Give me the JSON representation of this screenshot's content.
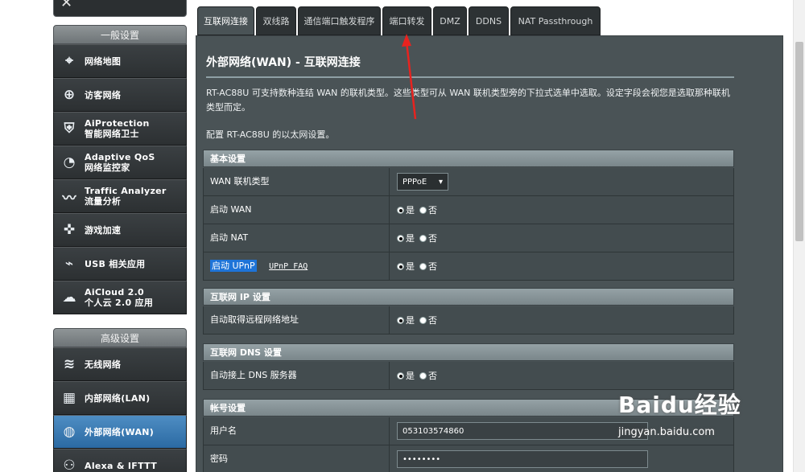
{
  "sidebar": {
    "top_label": "",
    "general_header": "一般设置",
    "advanced_header": "高级设置",
    "general_items": [
      {
        "icon": "network-map-icon",
        "line1": "网络地图",
        "line2": ""
      },
      {
        "icon": "guest-network-icon",
        "line1": "访客网络",
        "line2": ""
      },
      {
        "icon": "aiprotection-icon",
        "line1": "AiProtection",
        "line2": "智能网络卫士"
      },
      {
        "icon": "adaptive-qos-icon",
        "line1": "Adaptive QoS",
        "line2": "网络监控家"
      },
      {
        "icon": "traffic-analyzer-icon",
        "line1": "Traffic Analyzer",
        "line2": "流量分析"
      },
      {
        "icon": "game-boost-icon",
        "line1": "游戏加速",
        "line2": ""
      },
      {
        "icon": "usb-icon",
        "line1": "USB 相关应用",
        "line2": ""
      },
      {
        "icon": "aicloud-icon",
        "line1": "AiCloud 2.0",
        "line2": "个人云 2.0 应用"
      }
    ],
    "advanced_items": [
      {
        "icon": "wireless-icon",
        "line1": "无线网络",
        "line2": "",
        "active": false
      },
      {
        "icon": "lan-icon",
        "line1": "内部网络(LAN)",
        "line2": "",
        "active": false
      },
      {
        "icon": "wan-globe-icon",
        "line1": "外部网络(WAN)",
        "line2": "",
        "active": true
      },
      {
        "icon": "alexa-icon",
        "line1": "Alexa & IFTTT",
        "line2": "",
        "active": false
      }
    ]
  },
  "tabs": [
    {
      "label": "互联网连接",
      "active": true
    },
    {
      "label": "双线路",
      "active": false
    },
    {
      "label": "通信端口触发程序",
      "active": false
    },
    {
      "label": "端口转发",
      "active": false
    },
    {
      "label": "DMZ",
      "active": false
    },
    {
      "label": "DDNS",
      "active": false
    },
    {
      "label": "NAT Passthrough",
      "active": false
    }
  ],
  "main": {
    "title": "外部网络(WAN) - 互联网连接",
    "description": "RT-AC88U 可支持数种连结 WAN 的联机类型。这些类型可从 WAN 联机类型旁的下拉式选单中选取。设定字段会视您是选取那种联机类型而定。",
    "config_note": "配置 RT-AC88U 的以太网设置。"
  },
  "sections": {
    "basic": {
      "header": "基本设置",
      "wan_type_label": "WAN 联机类型",
      "wan_type_value": "PPPoE",
      "enable_wan_label": "启动 WAN",
      "enable_nat_label": "启动 NAT",
      "enable_upnp_label": "启动 UPnP",
      "upnp_faq": "UPnP  FAQ"
    },
    "ip": {
      "header": "互联网 IP 设置",
      "auto_ip_label": "自动取得远程网络地址"
    },
    "dns": {
      "header": "互联网 DNS 设置",
      "auto_dns_label": "自动接上 DNS 服务器"
    },
    "account": {
      "header": "帐号设置",
      "username_label": "用户名",
      "username_value": "053103574860",
      "password_label": "密码",
      "password_value": "••••••••"
    }
  },
  "radio": {
    "yes": "是",
    "no": "否"
  },
  "watermark": {
    "brand": "Baidu经验",
    "url": "jingyan.baidu.com"
  },
  "colors": {
    "accent": "#1e74d8",
    "panel": "#4a5356",
    "sidebar_active": "#2b6aa3",
    "annotation": "#e8231f"
  }
}
